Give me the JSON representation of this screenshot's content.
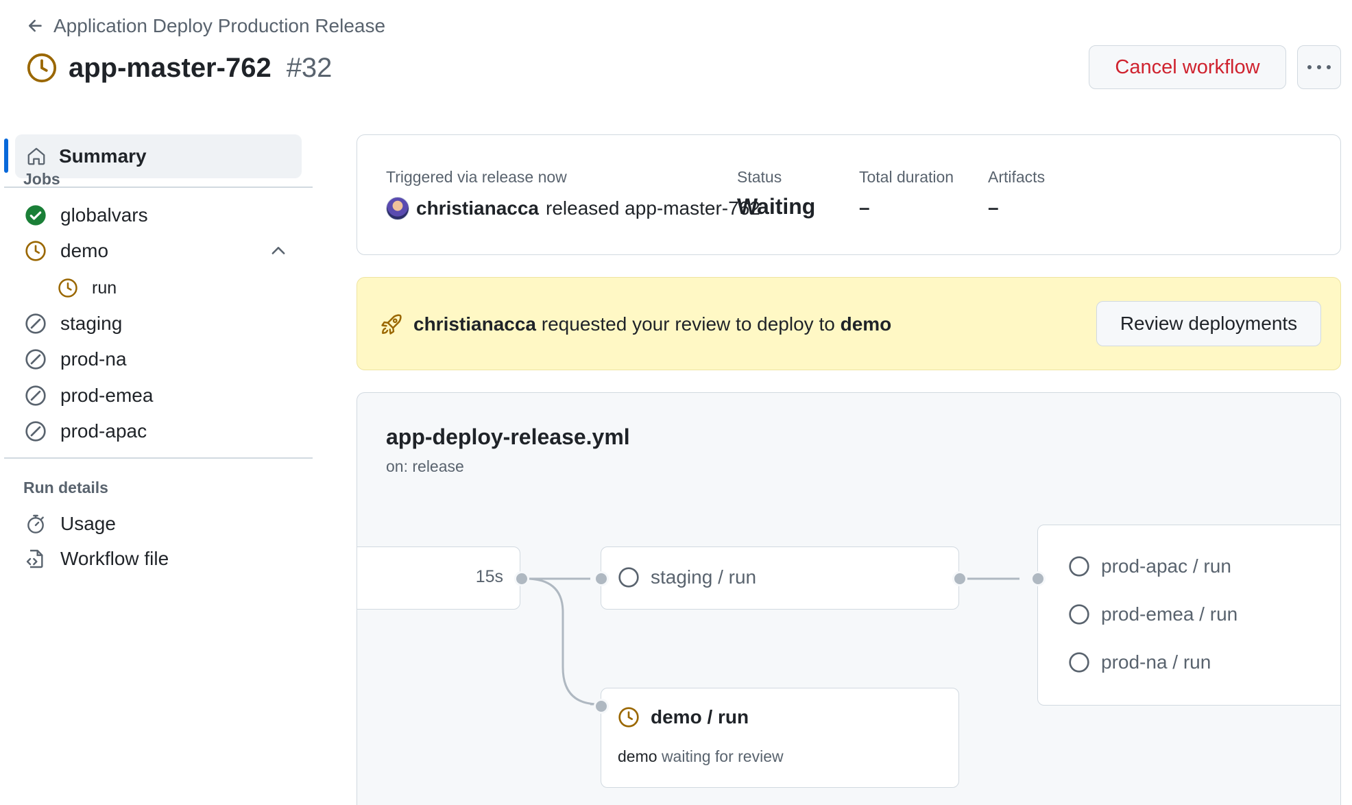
{
  "header": {
    "back_label": "Application Deploy Production Release",
    "run_name": "app-master-762",
    "run_number": "#32",
    "cancel_label": "Cancel workflow"
  },
  "sidebar": {
    "summary_label": "Summary",
    "jobs_heading": "Jobs",
    "jobs": [
      {
        "label": "globalvars",
        "status": "success"
      },
      {
        "label": "demo",
        "status": "waiting"
      },
      {
        "label": "run",
        "status": "waiting"
      },
      {
        "label": "staging",
        "status": "skipped"
      },
      {
        "label": "prod-na",
        "status": "skipped"
      },
      {
        "label": "prod-emea",
        "status": "skipped"
      },
      {
        "label": "prod-apac",
        "status": "skipped"
      }
    ],
    "run_details_heading": "Run details",
    "run_details": [
      {
        "label": "Usage",
        "icon": "stopwatch-icon"
      },
      {
        "label": "Workflow file",
        "icon": "file-code-icon"
      }
    ]
  },
  "summary": {
    "trigger_label": "Triggered via release now",
    "actor": "christianacca",
    "trigger_action": "released app-master-762",
    "status_label": "Status",
    "status_value": "Waiting",
    "duration_label": "Total duration",
    "duration_value": "–",
    "artifacts_label": "Artifacts",
    "artifacts_value": "–"
  },
  "review_banner": {
    "actor": "christianacca",
    "message": "requested your review to deploy to",
    "environment": "demo",
    "button_label": "Review deployments"
  },
  "workflow": {
    "file_name": "app-deploy-release.yml",
    "trigger": "on: release",
    "first_node_duration": "15s",
    "staging_node": "staging / run",
    "demo_node": "demo / run",
    "demo_env": "demo",
    "demo_sub": "waiting for review",
    "prod_nodes": [
      "prod-apac / run",
      "prod-emea / run",
      "prod-na / run"
    ]
  },
  "colors": {
    "accent": "#0969da",
    "success": "#1a7f37",
    "waiting": "#9a6700",
    "danger": "#cf222e",
    "banner_bg": "#fff8c5"
  }
}
